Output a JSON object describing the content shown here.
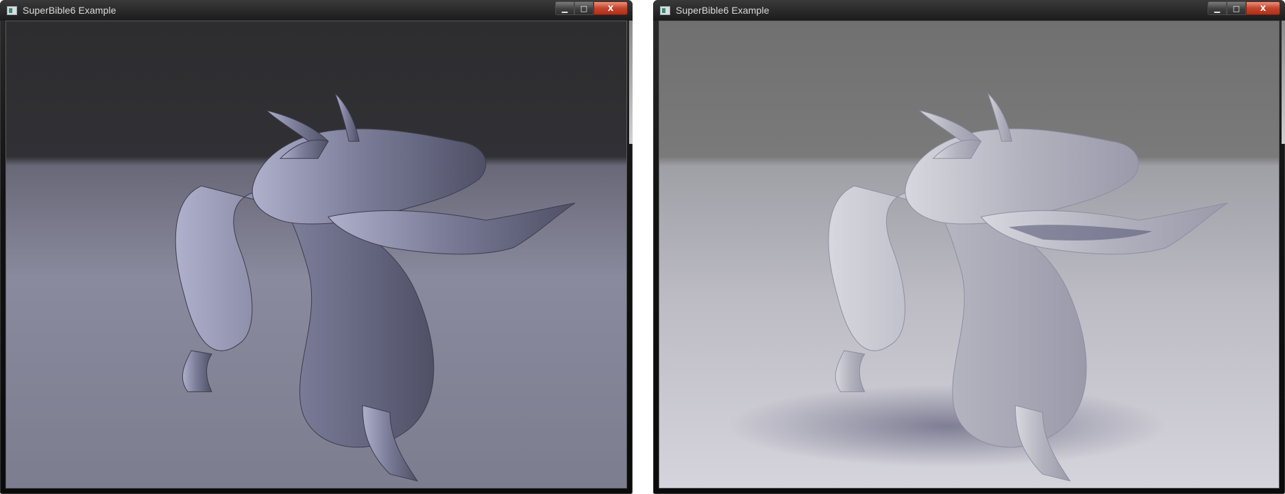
{
  "windows": [
    {
      "title": "SuperBible6 Example",
      "controls": {
        "minimize": "▁",
        "maximize": "□",
        "close": "X"
      }
    },
    {
      "title": "SuperBible6 Example",
      "controls": {
        "minimize": "▁",
        "maximize": "□",
        "close": "X"
      }
    }
  ],
  "scene": {
    "subject": "dragon-model"
  },
  "colors": {
    "left_background_top": "#2d2d30",
    "left_floor": "#8a8a9e",
    "left_dragon": "#7a7c98",
    "right_background_top": "#707070",
    "right_floor": "#c7c6cf",
    "right_dragon": "#b7b7c2"
  }
}
